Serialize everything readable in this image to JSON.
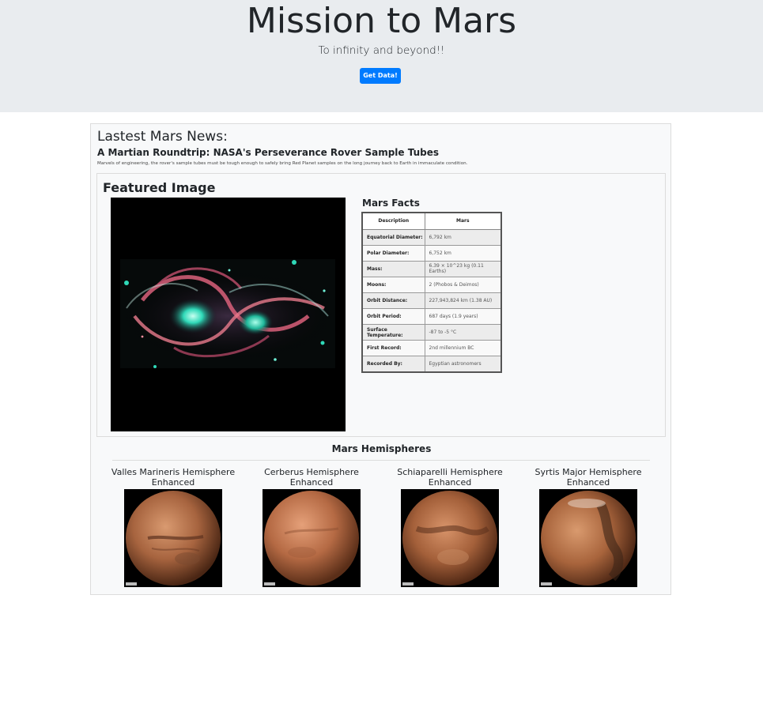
{
  "header": {
    "title": "Mission to Mars",
    "subtitle": "To infinity and beyond!!",
    "button_label": "Get Data!"
  },
  "news": {
    "heading": "Lastest Mars News:",
    "title": "A Martian Roundtrip: NASA's Perseverance Rover Sample Tubes",
    "paragraph": "Marvels of engineering, the rover's sample tubes must be tough enough to safely bring Red Planet samples on the long journey back to Earth in immaculate condition."
  },
  "featured": {
    "heading": "Featured Image"
  },
  "facts": {
    "heading": "Mars Facts",
    "columns": [
      "Description",
      "Mars"
    ],
    "rows": [
      {
        "label": "Equatorial Diameter:",
        "value": "6,792 km"
      },
      {
        "label": "Polar Diameter:",
        "value": "6,752 km"
      },
      {
        "label": "Mass:",
        "value": "6.39 × 10^23 kg (0.11 Earths)"
      },
      {
        "label": "Moons:",
        "value": "2 (Phobos & Deimos)"
      },
      {
        "label": "Orbit Distance:",
        "value": "227,943,824 km (1.38 AU)"
      },
      {
        "label": "Orbit Period:",
        "value": "687 days (1.9 years)"
      },
      {
        "label": "Surface Temperature:",
        "value": "-87 to -5 °C"
      },
      {
        "label": "First Record:",
        "value": "2nd millennium BC"
      },
      {
        "label": "Recorded By:",
        "value": "Egyptian astronomers"
      }
    ]
  },
  "hemispheres": {
    "heading": "Mars Hemispheres",
    "items": [
      {
        "title": "Valles Marineris Hemisphere Enhanced"
      },
      {
        "title": "Cerberus Hemisphere Enhanced"
      },
      {
        "title": "Schiaparelli Hemisphere Enhanced"
      },
      {
        "title": "Syrtis Major Hemisphere Enhanced"
      }
    ]
  }
}
